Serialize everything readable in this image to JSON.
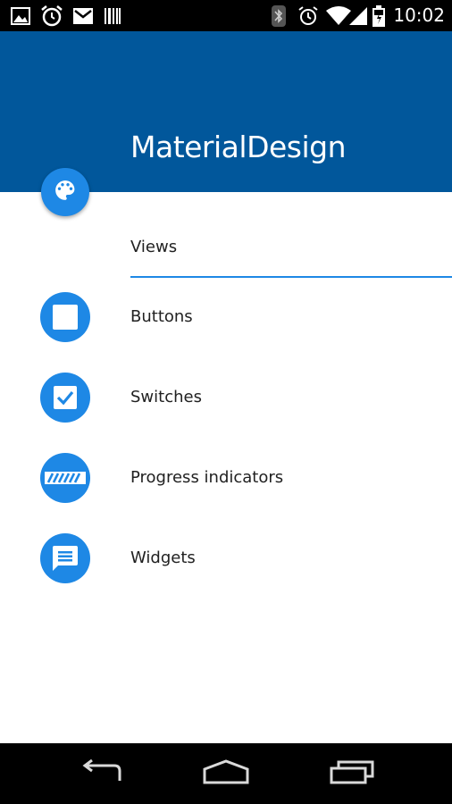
{
  "status_bar": {
    "time": "10:02",
    "left_icons": [
      "image-icon",
      "alarm-clock-icon",
      "mail-icon",
      "barcode-icon"
    ],
    "right_icons": [
      "bluetooth-icon",
      "alarm-icon",
      "wifi-icon",
      "signal-icon",
      "battery-icon"
    ]
  },
  "app_bar": {
    "title": "MaterialDesign",
    "background": "#01579b",
    "fab_icon": "palette-icon"
  },
  "section": {
    "label": "Views",
    "divider_color": "#1e88e5"
  },
  "list": {
    "items": [
      {
        "label": "Buttons",
        "icon": "square-icon"
      },
      {
        "label": "Switches",
        "icon": "checkbox-icon"
      },
      {
        "label": "Progress indicators",
        "icon": "progress-bar-icon"
      },
      {
        "label": "Widgets",
        "icon": "message-icon"
      }
    ],
    "accent": "#1e88e5"
  },
  "nav_bar": {
    "buttons": [
      "back-icon",
      "home-icon",
      "recents-icon"
    ]
  }
}
